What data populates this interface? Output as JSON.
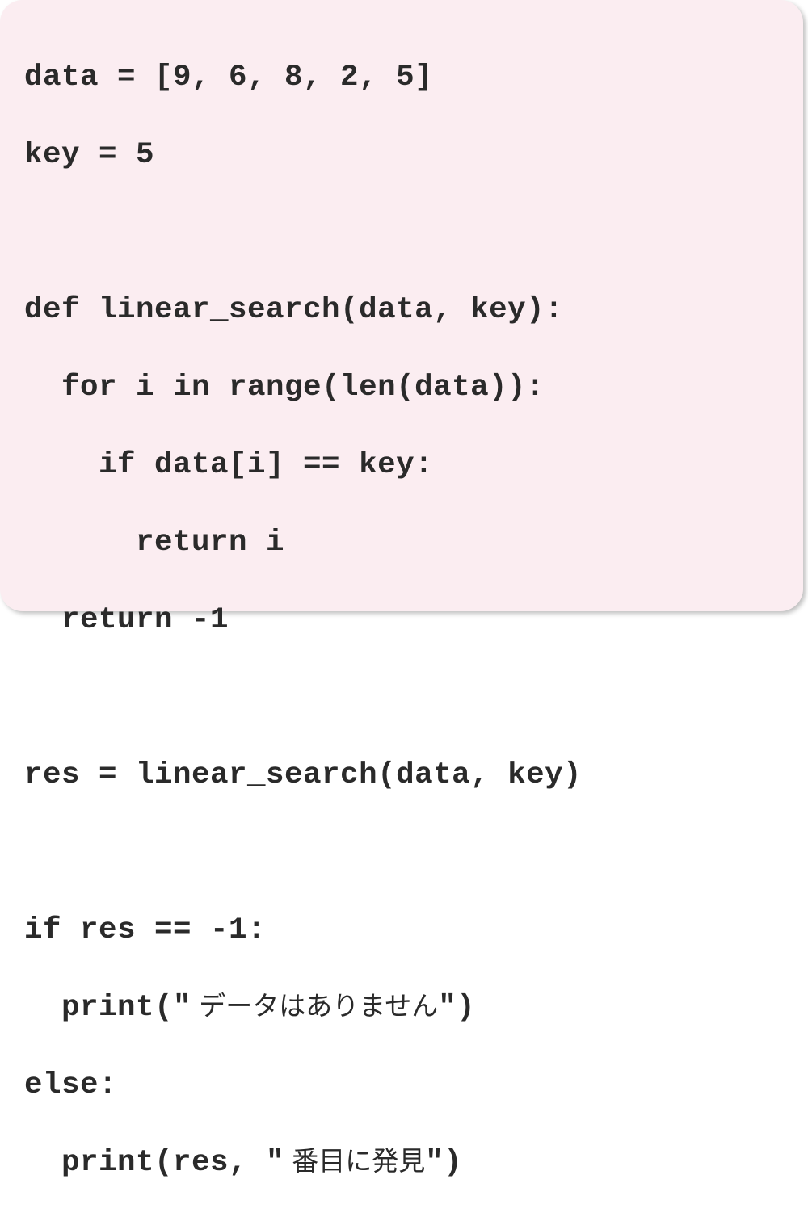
{
  "code": {
    "lines": [
      {
        "text": "data = [9, 6, 8, 2, 5]",
        "jp": ""
      },
      {
        "text": "key = 5",
        "jp": ""
      },
      {
        "text": "",
        "jp": ""
      },
      {
        "text": "def linear_search(data, key):",
        "jp": ""
      },
      {
        "text": "  for i in range(len(data)):",
        "jp": ""
      },
      {
        "text": "    if data[i] == key:",
        "jp": ""
      },
      {
        "text": "      return i",
        "jp": ""
      },
      {
        "text": "  return -1",
        "jp": ""
      },
      {
        "text": "",
        "jp": ""
      },
      {
        "text": "res = linear_search(data, key)",
        "jp": ""
      },
      {
        "text": "",
        "jp": ""
      },
      {
        "text": "if res == -1:",
        "jp": ""
      },
      {
        "text": "  print(\"",
        "jp": " データはありません",
        "suffix": "\")"
      },
      {
        "text": "else:",
        "jp": ""
      },
      {
        "text": "  print(res, \"",
        "jp": " 番目に発見",
        "suffix": "\")"
      }
    ]
  }
}
